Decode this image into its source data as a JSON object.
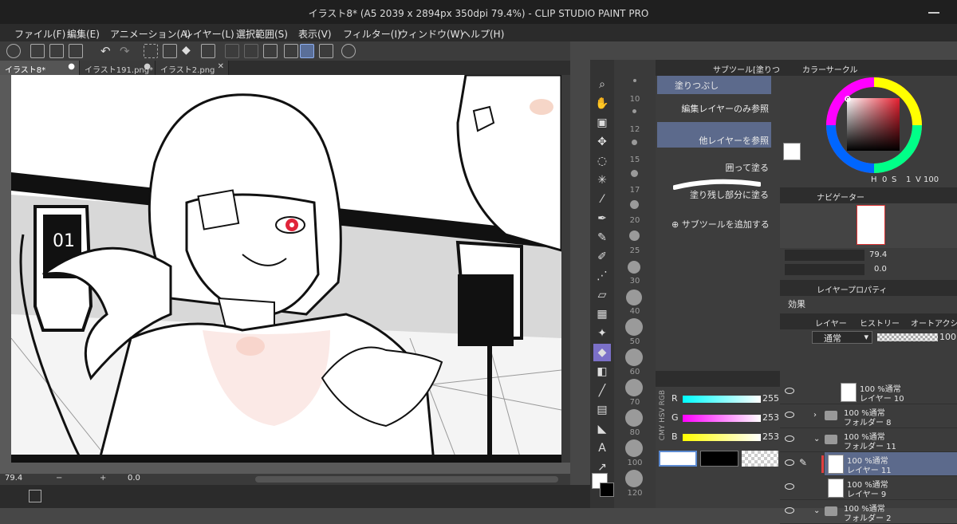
{
  "window": {
    "title": "イラスト8* (A5 2039 x 2894px 350dpi 79.4%) - CLIP STUDIO PAINT PRO"
  },
  "menu": [
    "ファイル(F)",
    "編集(E)",
    "アニメーション(A)",
    "レイヤー(L)",
    "選択範囲(S)",
    "表示(V)",
    "フィルター(I)",
    "ウィンドウ(W)",
    "ヘルプ(H)"
  ],
  "tabs": [
    {
      "label": "イラスト8*"
    },
    {
      "label": "イラスト191.png*"
    },
    {
      "label": "イラスト2.png"
    }
  ],
  "status": {
    "zoom": "79.4",
    "angle": "0.0"
  },
  "brush_sizes": [
    "10",
    "12",
    "15",
    "17",
    "20",
    "25",
    "30",
    "40",
    "50",
    "60",
    "70",
    "80",
    "100",
    "120"
  ],
  "subtool": {
    "header": "サブツール[塗りつぶし]",
    "group": "塗りつぶし",
    "items": [
      {
        "label": "編集レイヤーのみ参照"
      },
      {
        "label": "他レイヤーを参照"
      },
      {
        "label": "囲って塗る"
      },
      {
        "label": "塗り残し部分に塗る"
      }
    ],
    "add_label": "サブツールを追加する"
  },
  "color_slider": {
    "mode": "RGB",
    "side_label": "CMY HSV RGB",
    "r_label": "R",
    "r": "255",
    "g_label": "G",
    "g": "253",
    "b_label": "B",
    "b": "253"
  },
  "color_circle": {
    "title": "カラーサークル",
    "h_label": "H",
    "h": "0",
    "s_label": "S",
    "s": "1",
    "v_label": "V",
    "v": "100"
  },
  "navigator": {
    "title": "ナビゲーター",
    "zoom": "79.4",
    "angle": "0.0"
  },
  "layer_property": {
    "title": "レイヤープロパティ",
    "effect_label": "効果"
  },
  "layer_panel": {
    "tabs": [
      "レイヤー",
      "ヒストリー",
      "オートアクション"
    ],
    "blend_mode": "通常",
    "opacity": "100"
  },
  "layers": [
    {
      "opacity_mode": "100 %通常",
      "name": "レイヤー 10",
      "type": "raster"
    },
    {
      "opacity_mode": "100 %通常",
      "name": "フォルダー 8",
      "type": "folder"
    },
    {
      "opacity_mode": "100 %通常",
      "name": "フォルダー 11",
      "type": "folder"
    },
    {
      "opacity_mode": "100 %通常",
      "name": "レイヤー 11",
      "type": "raster",
      "selected": true
    },
    {
      "opacity_mode": "100 %通常",
      "name": "レイヤー 9",
      "type": "raster"
    },
    {
      "opacity_mode": "100 %通常",
      "name": "フォルダー 2",
      "type": "folder"
    }
  ],
  "colors": {
    "accent": "#5c6a8c",
    "tool_selected": "#7b70c8",
    "main_color": "#fffdfd"
  }
}
